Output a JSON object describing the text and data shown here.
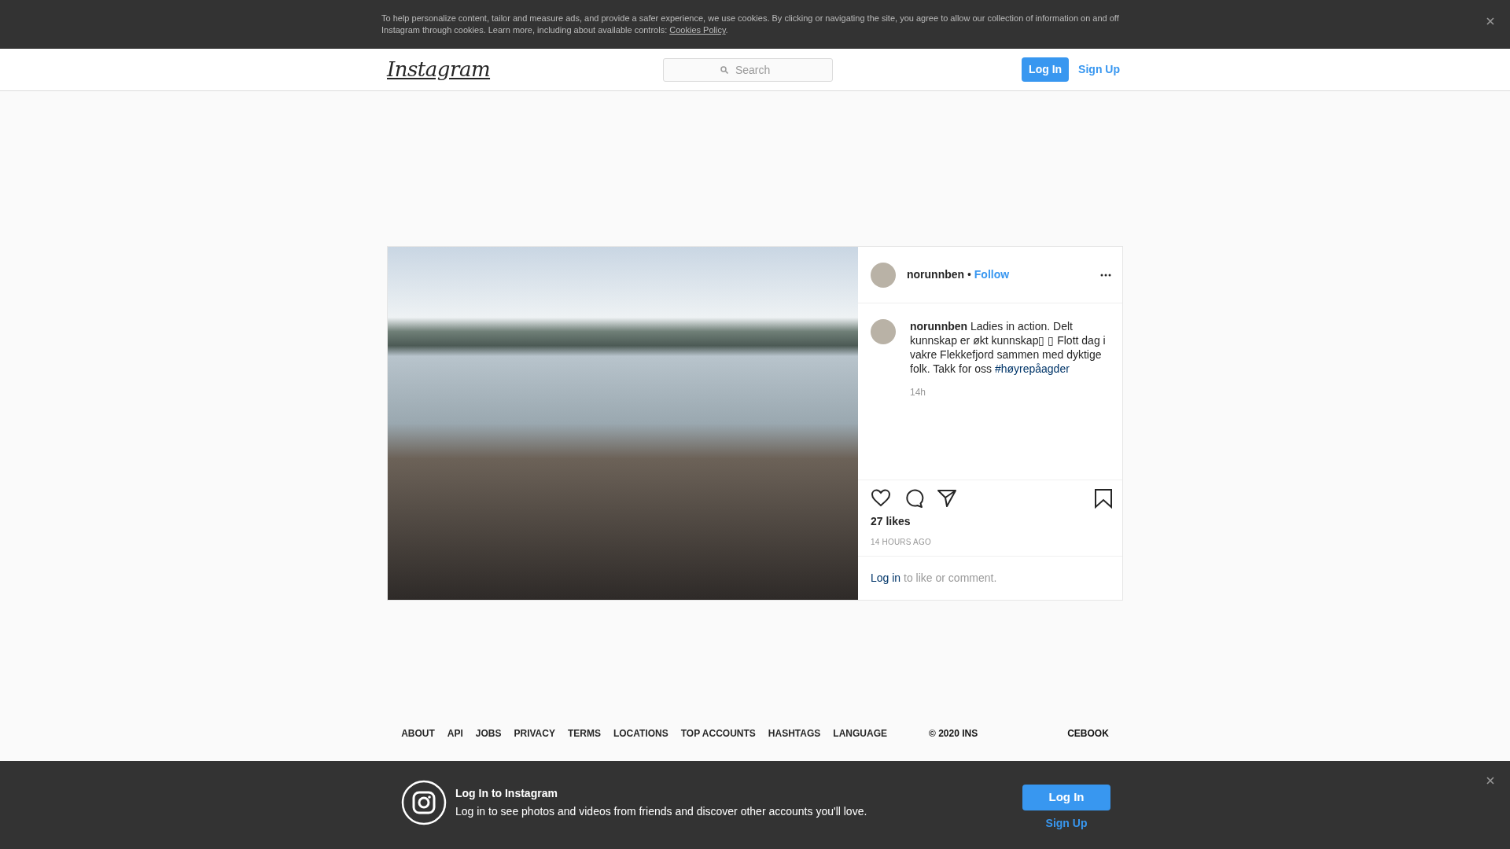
{
  "cookie_banner": {
    "text": "To help personalize content, tailor and measure ads, and provide a safer experience, we use cookies. By clicking or navigating the site, you agree to allow our collection of information on and off Instagram through cookies. Learn more, including about available controls: ",
    "link": "Cookies Policy",
    "text_after": "."
  },
  "header": {
    "logo": "Instagram",
    "search": {
      "placeholder": "Search"
    },
    "buttons": [
      {
        "label": "Log In",
        "kind": "primary"
      },
      {
        "label": "Sign Up",
        "kind": "link"
      }
    ]
  },
  "post": {
    "username": "norunnben",
    "separator": "•",
    "follow": "Follow",
    "caption": {
      "username": "norunnben",
      "text": "Ladies in action. Delt kunnskap er økt kunnskap▯ ▯  Flott dag i vakre Flekkefjord sammen med dyktige folk. Takk for oss ",
      "hashtag": "#høyrepåagder",
      "time": "14h"
    },
    "likes": "27 likes",
    "date": "14 HOURS AGO",
    "login_prompt": {
      "link": "Log in",
      "text": "to like or comment."
    }
  },
  "footer": {
    "links": [
      "ABOUT",
      "API",
      "JOBS",
      "PRIVACY",
      "TERMS",
      "LOCATIONS",
      "TOP ACCOUNTS",
      "HASHTAGS",
      "LANGUAGE"
    ],
    "copyright_fragments": [
      "© 2020 INS",
      "CEBOOK"
    ]
  },
  "login_bar": {
    "title": "Log In to Instagram",
    "subtitle": "Log in to see photos and videos from friends and discover other accounts you'll love.",
    "buttons": [
      {
        "label": "Log In",
        "kind": "primary"
      },
      {
        "label": "Sign Up",
        "kind": "link"
      }
    ]
  }
}
